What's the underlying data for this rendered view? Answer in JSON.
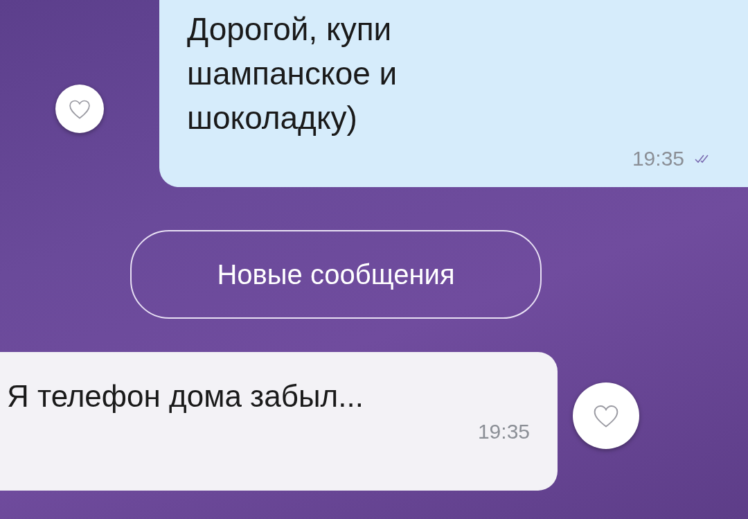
{
  "messages": [
    {
      "kind": "outgoing",
      "text": "Дорогой, купи шампанское и шоколадку)",
      "time": "19:35",
      "read": true
    },
    {
      "kind": "divider",
      "text": "Новые сообщения"
    },
    {
      "kind": "incoming",
      "text": "Я телефон дома забыл...",
      "time": "19:35"
    }
  ]
}
